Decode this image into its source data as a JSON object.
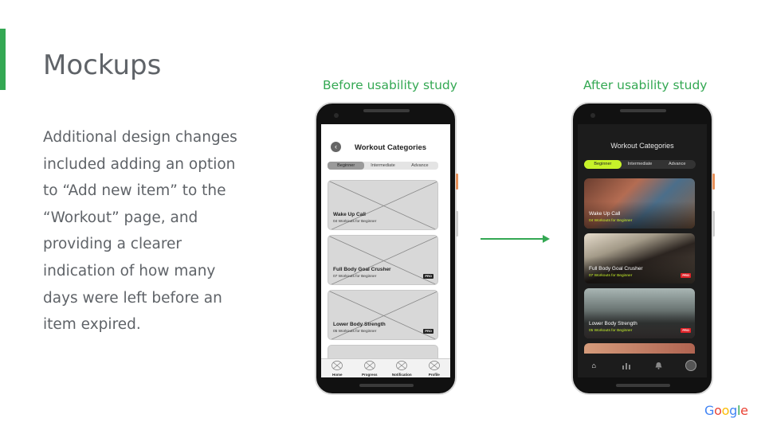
{
  "slide": {
    "title": "Mockups",
    "body": "Additional design changes included adding an option to “Add new item” to the “Workout” page, and providing a clearer indication of how many days were left before an item expired.",
    "accent_color": "#34a853",
    "text_color": "#5f6368"
  },
  "before": {
    "caption": "Before usability study",
    "screen_title": "Workout Categories",
    "tabs": [
      "Beginner",
      "Intermediate",
      "Advance"
    ],
    "cards": [
      {
        "title": "Wake Up Call",
        "sub": "04 Workouts  for Beginner",
        "badge": ""
      },
      {
        "title": "Full Body Goal Crusher",
        "sub": "07 Workouts  for Beginner",
        "badge": "PRO"
      },
      {
        "title": "Lower Body Strength",
        "sub": "05 Workouts  for Beginner",
        "badge": "PRO"
      }
    ],
    "nav": [
      "Home",
      "Progress",
      "Notification",
      "Profile"
    ]
  },
  "after": {
    "caption": "After usability study",
    "screen_title": "Workout Categories",
    "tabs": [
      "Beginner",
      "Intermediate",
      "Advance"
    ],
    "accent": "#c7f22a",
    "cards": [
      {
        "title": "Wake Up Call",
        "sub": "04 Workouts  for Beginner",
        "badge": ""
      },
      {
        "title": "Full Body Goal Crusher",
        "sub": "07 Workouts  for Beginner",
        "badge": "PRO"
      },
      {
        "title": "Lower Body Strength",
        "sub": "05 Workouts  for Beginner",
        "badge": "PRO"
      }
    ],
    "nav_icons": [
      "home-icon",
      "bar-chart-icon",
      "bell-icon",
      "avatar"
    ]
  },
  "logo": {
    "letters": [
      "G",
      "o",
      "o",
      "g",
      "l",
      "e"
    ],
    "colors": [
      "#4285f4",
      "#ea4335",
      "#fbbc05",
      "#4285f4",
      "#34a853",
      "#ea4335"
    ]
  }
}
